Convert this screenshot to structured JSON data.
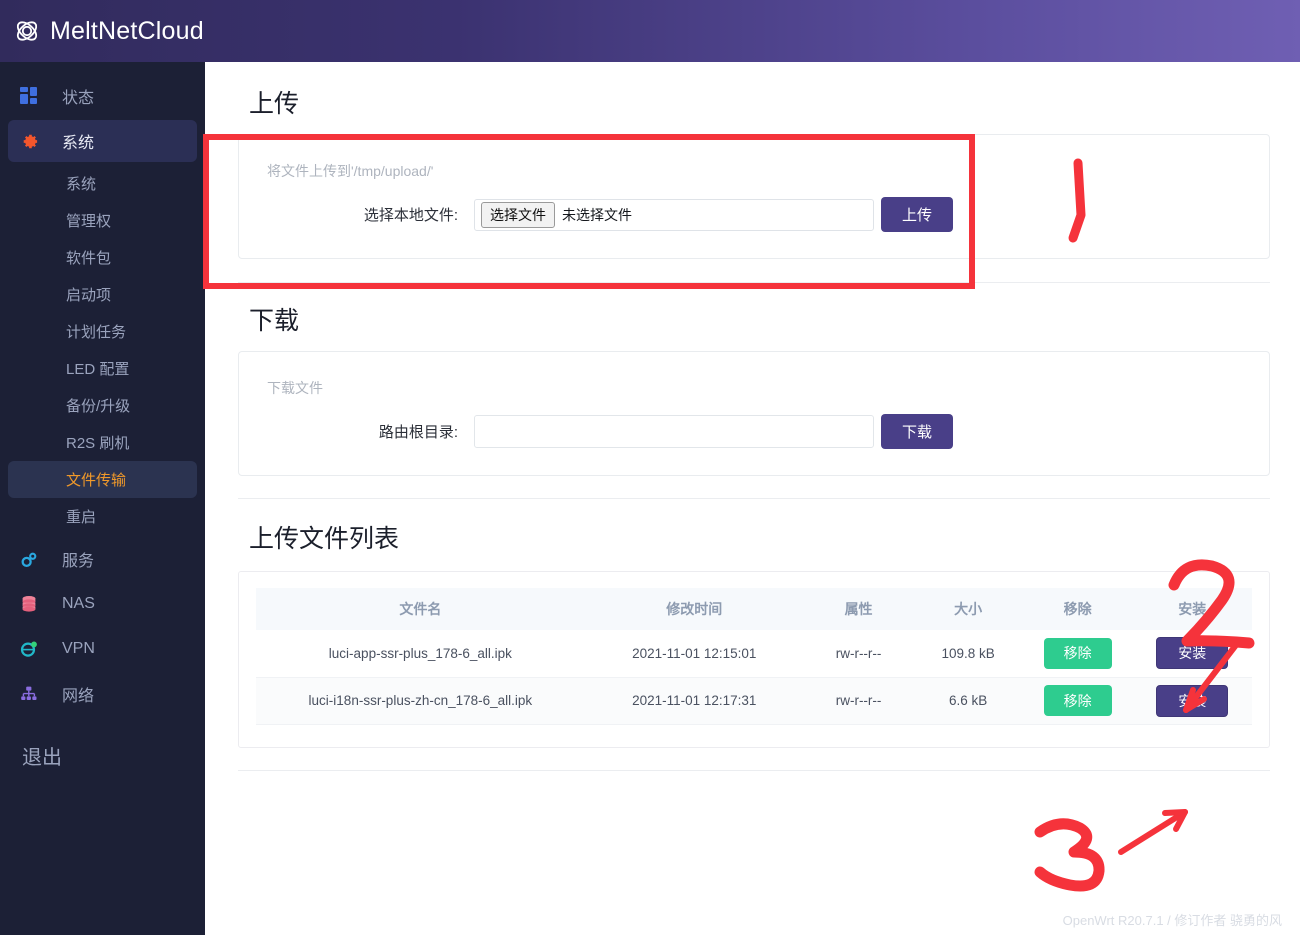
{
  "header": {
    "brand": "MeltNetCloud",
    "brand_icon": "atom-icon"
  },
  "sidebar": {
    "items": [
      {
        "label": "状态",
        "icon": "dashboard-icon",
        "active": false
      },
      {
        "label": "系统",
        "icon": "gear-icon",
        "active": true
      }
    ],
    "sub_items": [
      {
        "label": "系统",
        "active": false
      },
      {
        "label": "管理权",
        "active": false
      },
      {
        "label": "软件包",
        "active": false
      },
      {
        "label": "启动项",
        "active": false
      },
      {
        "label": "计划任务",
        "active": false
      },
      {
        "label": "LED 配置",
        "active": false
      },
      {
        "label": "备份/升级",
        "active": false
      },
      {
        "label": "R2S 刷机",
        "active": false
      },
      {
        "label": "文件传输",
        "active": true
      },
      {
        "label": "重启",
        "active": false
      }
    ],
    "lower_items": [
      {
        "label": "服务",
        "icon": "gears-icon"
      },
      {
        "label": "NAS",
        "icon": "database-icon"
      },
      {
        "label": "VPN",
        "icon": "globe-shield-icon"
      },
      {
        "label": "网络",
        "icon": "network-icon"
      }
    ],
    "logout": "退出"
  },
  "upload": {
    "title": "上传",
    "hint": "将文件上传到'/tmp/upload/'",
    "label": "选择本地文件:",
    "choose_button": "选择文件",
    "file_status": "未选择文件",
    "submit": "上传"
  },
  "download": {
    "title": "下载",
    "hint": "下载文件",
    "label": "路由根目录:",
    "value": "",
    "placeholder": "",
    "submit": "下载"
  },
  "filelist": {
    "title": "上传文件列表",
    "columns": [
      "文件名",
      "修改时间",
      "属性",
      "大小",
      "移除",
      "安装"
    ],
    "rows": [
      {
        "name": "luci-app-ssr-plus_178-6_all.ipk",
        "mtime": "2021-11-01 12:15:01",
        "attr": "rw-r--r--",
        "size": "109.8 kB",
        "remove": "移除",
        "install": "安装"
      },
      {
        "name": "luci-i18n-ssr-plus-zh-cn_178-6_all.ipk",
        "mtime": "2021-11-01 12:17:31",
        "attr": "rw-r--r--",
        "size": "6.6 kB",
        "remove": "移除",
        "install": "安装"
      }
    ]
  },
  "footer": {
    "text": "OpenWrt R20.7.1 / 修订作者 骁勇的风"
  },
  "annotations": {
    "marks": [
      "1",
      "2",
      "3"
    ],
    "color": "#f5333b"
  },
  "colors": {
    "brand_gradient_start": "#312b5c",
    "brand_gradient_end": "#6f5fb3",
    "sidebar_bg": "#1c2036",
    "accent_purple": "#493f88",
    "accent_green": "#2ecc8f",
    "active_orange": "#f0992a",
    "annotation_red": "#f5333b"
  }
}
